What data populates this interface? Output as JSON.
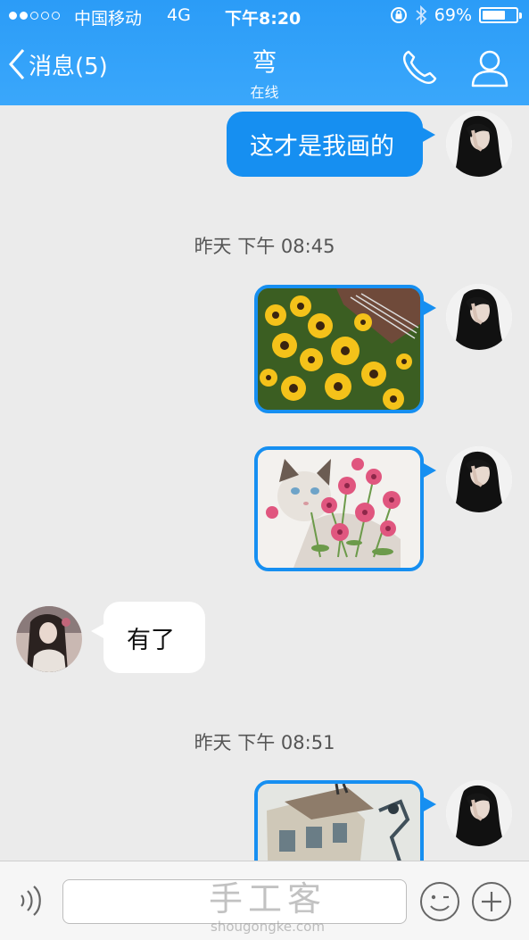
{
  "status_bar": {
    "carrier": "中国移动",
    "network": "4G",
    "time": "下午8:20",
    "battery": "69%",
    "battery_level": 0.69,
    "signal_bars_filled": 2,
    "signal_bars_total": 5
  },
  "nav": {
    "back_label": "消息(5)",
    "title": "弯",
    "subtitle": "在线"
  },
  "messages": {
    "m1_text": "这才是我画的",
    "t1": "昨天 下午 08:45",
    "m4_text": "有了",
    "t2": "昨天 下午 08:51"
  },
  "input": {
    "placeholder": ""
  },
  "watermark": {
    "cn": "手工客",
    "en": "shougongke.com"
  },
  "colors": {
    "accent": "#168ff1",
    "header": "#2b9cf7",
    "background": "#ebebeb"
  }
}
